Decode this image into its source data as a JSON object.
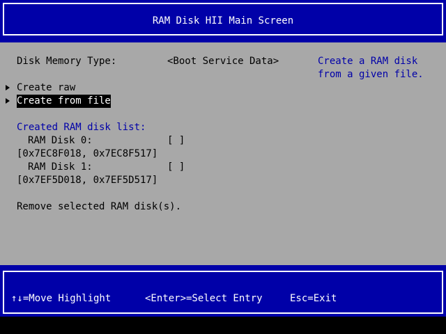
{
  "title": "RAM Disk HII Main Screen",
  "main": {
    "memory_type": {
      "label": "Disk Memory Type:",
      "value": "<Boot Service Data>"
    },
    "help_text": [
      "Create a RAM disk",
      "from a given file."
    ],
    "menu": [
      {
        "label": "Create raw",
        "selected": false
      },
      {
        "label": "Create from file",
        "selected": true
      }
    ],
    "list_title": "Created RAM disk list:",
    "disks": [
      {
        "name": "RAM Disk 0:",
        "checkbox": "[ ]",
        "range": "[0x7EC8F018, 0x7EC8F517]"
      },
      {
        "name": "RAM Disk 1:",
        "checkbox": "[ ]",
        "range": "[0x7EF5D018, 0x7EF5D517]"
      }
    ],
    "remove_label": "Remove selected RAM disk(s)."
  },
  "footer": {
    "move": "↑↓=Move Highlight",
    "select": "<Enter>=Select Entry",
    "exit": "Esc=Exit"
  },
  "colors": {
    "title_bg": "#0000a8",
    "main_bg": "#a8a8a8",
    "help_text": "#0000a8",
    "highlight_bg": "#000000",
    "highlight_fg": "#ffffff"
  }
}
